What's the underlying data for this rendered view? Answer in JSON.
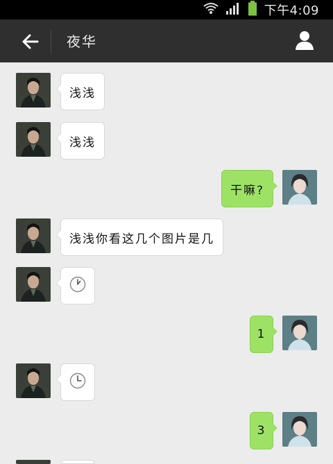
{
  "status_bar": {
    "time": "下午4:09",
    "icons": [
      "wifi-icon",
      "signal-icon",
      "battery-icon"
    ]
  },
  "header": {
    "title": "夜华",
    "back_icon": "back-arrow-icon",
    "profile_icon": "person-icon"
  },
  "messages": [
    {
      "side": "in",
      "text": "浅浅"
    },
    {
      "side": "in",
      "text": "浅浅"
    },
    {
      "side": "out",
      "text": "干嘛?"
    },
    {
      "side": "in",
      "text": "浅浅你看这几个图片是几"
    },
    {
      "side": "in",
      "text": "",
      "icon": "clock-icon"
    },
    {
      "side": "out",
      "text": "1"
    },
    {
      "side": "in",
      "text": "",
      "icon": "clock-icon"
    },
    {
      "side": "out",
      "text": "3"
    }
  ],
  "colors": {
    "outgoing_bubble": "#9ee265",
    "incoming_bubble": "#ffffff",
    "header": "#2f2f2f",
    "background": "#ececec"
  }
}
